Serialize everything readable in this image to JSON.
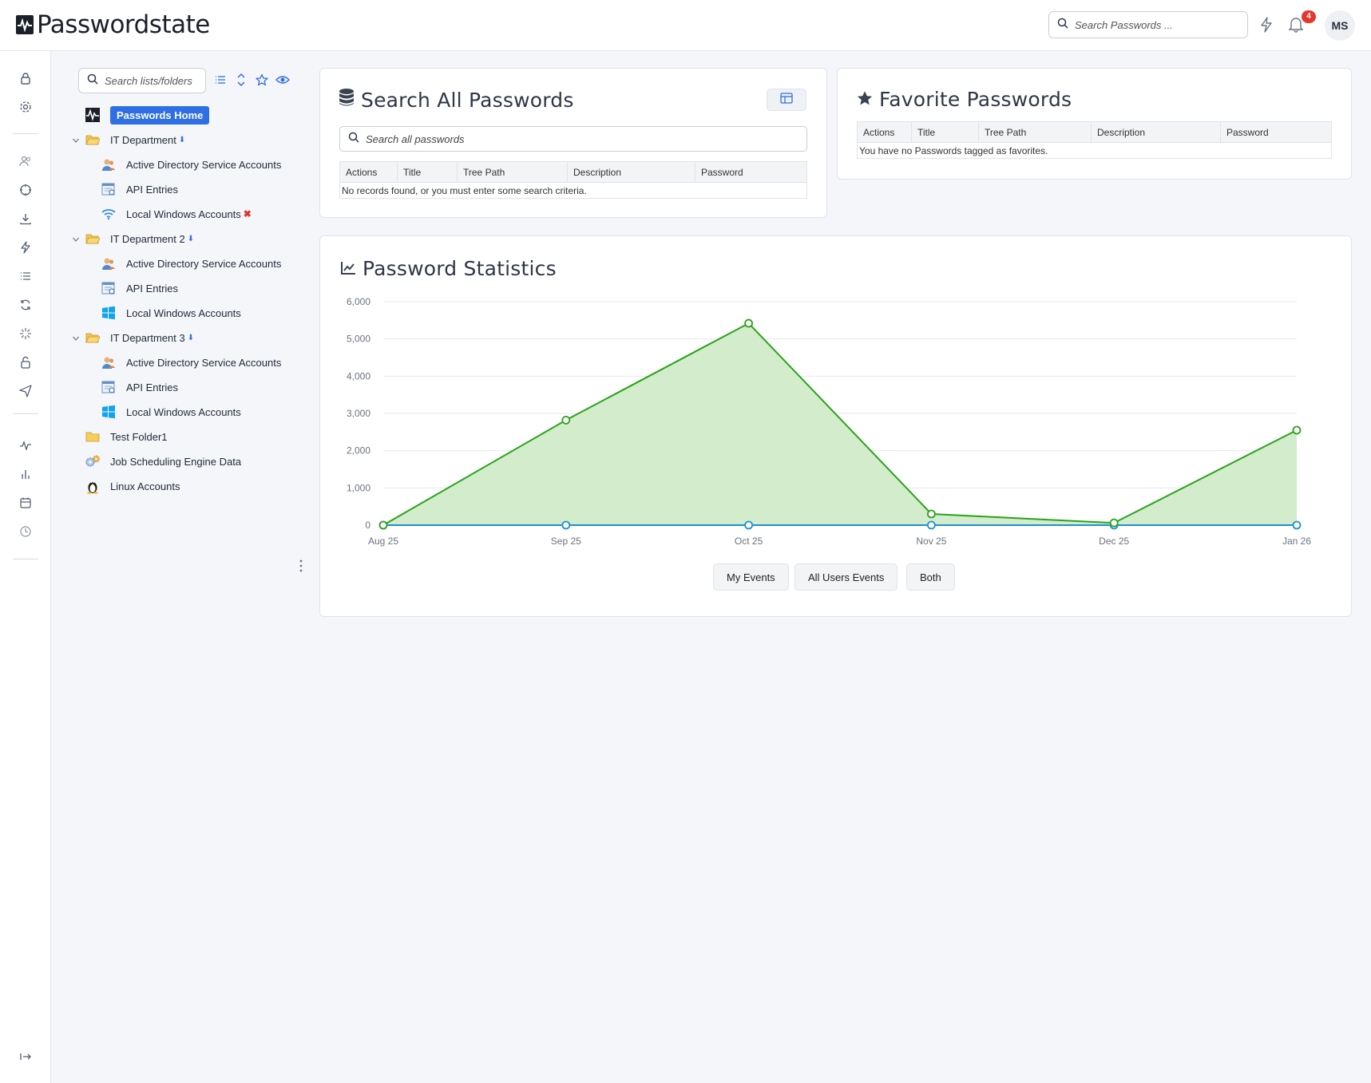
{
  "header": {
    "app_name": "Passwordstate",
    "search_placeholder": "Search Passwords ...",
    "notification_count": "4",
    "user_initials": "MS"
  },
  "tree": {
    "search_placeholder": "Search lists/folders",
    "home_label": "Passwords Home",
    "items": [
      {
        "label": "IT Department",
        "icon": "folder-open-icon",
        "level": 0,
        "expanded": true,
        "marker": "down-arrow"
      },
      {
        "label": "Active Directory Service Accounts",
        "icon": "user-accounts-icon",
        "level": 1
      },
      {
        "label": "API Entries",
        "icon": "api-icon",
        "level": 1
      },
      {
        "label": "Local Windows Accounts",
        "icon": "wifi-icon",
        "level": 1,
        "marker": "red-x"
      },
      {
        "label": "IT Department 2",
        "icon": "folder-open-icon",
        "level": 0,
        "expanded": true,
        "marker": "down-arrow"
      },
      {
        "label": "Active Directory Service Accounts",
        "icon": "user-accounts-icon",
        "level": 1
      },
      {
        "label": "API Entries",
        "icon": "api-icon",
        "level": 1
      },
      {
        "label": "Local Windows Accounts",
        "icon": "windows-icon",
        "level": 1
      },
      {
        "label": "IT Department 3",
        "icon": "folder-open-icon",
        "level": 0,
        "expanded": true,
        "marker": "down-arrow"
      },
      {
        "label": "Active Directory Service Accounts",
        "icon": "user-accounts-icon",
        "level": 1
      },
      {
        "label": "API Entries",
        "icon": "api-icon",
        "level": 1
      },
      {
        "label": "Local Windows Accounts",
        "icon": "windows-icon",
        "level": 1
      },
      {
        "label": "Test Folder1",
        "icon": "folder-icon",
        "level": 0
      },
      {
        "label": "Job Scheduling Engine Data",
        "icon": "gears-icon",
        "level": 0
      },
      {
        "label": "Linux Accounts",
        "icon": "linux-icon",
        "level": 0
      }
    ]
  },
  "search_all": {
    "title": "Search All Passwords",
    "placeholder": "Search all passwords",
    "columns": [
      "Actions",
      "Title",
      "Tree Path",
      "Description",
      "Password"
    ],
    "empty_message": "No records found, or you must enter some search criteria."
  },
  "favorites": {
    "title": "Favorite Passwords",
    "columns": [
      "Actions",
      "Title",
      "Tree Path",
      "Description",
      "Password"
    ],
    "empty_message": "You have no Passwords tagged as favorites."
  },
  "stats": {
    "title": "Password Statistics",
    "buttons": [
      "My Events",
      "All Users Events",
      "Both"
    ]
  },
  "chart_data": {
    "type": "area",
    "categories": [
      "Aug 25",
      "Sep 25",
      "Oct 25",
      "Nov 25",
      "Dec 25",
      "Jan 26"
    ],
    "y_ticks": [
      "0",
      "1,000",
      "2,000",
      "3,000",
      "4,000",
      "5,000",
      "6,000"
    ],
    "ylim": [
      0,
      6000
    ],
    "grid": true,
    "series": [
      {
        "values": [
          0,
          2820,
          5420,
          300,
          60,
          2550
        ],
        "color": "#2aa31a",
        "fill": "#cdeac6"
      },
      {
        "values": [
          0,
          0,
          0,
          0,
          0,
          0
        ],
        "color": "#1e8fd6"
      }
    ]
  },
  "colors": {
    "accent": "#2f6fe4",
    "badge": "#e5382d"
  }
}
